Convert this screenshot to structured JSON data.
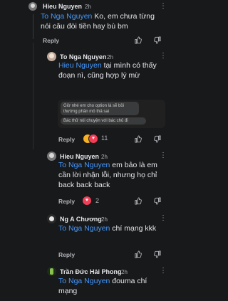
{
  "comments": [
    {
      "author": "Hieu Nguyen",
      "time": "2h",
      "mention": "To Nga Nguyen",
      "text": " Ko, em chưa từng nói câu đòi tiền hay bù bm",
      "reply_label": "Reply",
      "reactions": null
    },
    {
      "author": "To Nga Nguyen",
      "time": "2h",
      "mention": "Hieu Nguyen",
      "text": " tại mình có thấy đoạn nì, cũng hợp lý mừ",
      "reply_label": "Reply",
      "reactions": "11",
      "embed": {
        "line1": "Giờ nhé em cho option là sẽ bồi",
        "line2": "thường phần mô thả sai",
        "line3": "Bác thử nói chuyện với bác chủ đi"
      }
    },
    {
      "author": "Hieu Nguyen",
      "time": "2h",
      "mention": "To Nga Nguyen",
      "text": " em bảo là em cần lời nhận lỗi, nhưng họ chỉ back back back",
      "reply_label": "Reply",
      "reactions": "2"
    },
    {
      "author": "Ng A Chương",
      "time": "2h",
      "mention": "To Nga Nguyen",
      "text": " chí mạng kkk",
      "reply_label": "Reply",
      "reactions": null
    },
    {
      "author": "Trần Đức Hải Phong",
      "time": "2h",
      "mention": "To Nga Nguyen",
      "text": " đouma chí mạng",
      "reply_label": "",
      "reactions": null
    }
  ],
  "colors": {
    "background": "#18191a",
    "mention": "#4599ff",
    "text": "#e4e6eb",
    "muted": "#b0b3b8"
  }
}
